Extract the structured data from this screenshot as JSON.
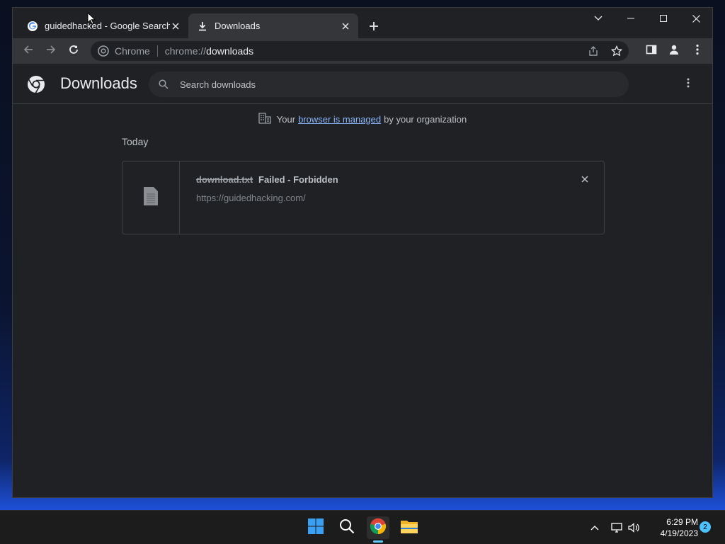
{
  "tabs": [
    {
      "label": "guidedhacked - Google Search",
      "icon": "google-g-icon"
    },
    {
      "label": "Downloads",
      "icon": "download-icon"
    }
  ],
  "omnibox": {
    "chip": "Chrome",
    "url_scheme": "chrome://",
    "url_host": "downloads"
  },
  "header": {
    "title": "Downloads",
    "search_placeholder": "Search downloads"
  },
  "managed": {
    "prefix": "Your",
    "link": "browser is managed",
    "suffix": "by your organization"
  },
  "section": {
    "day": "Today"
  },
  "download": {
    "filename": "download.txt",
    "status": "Failed - Forbidden",
    "url": "https://guidedhacking.com/"
  },
  "taskbar": {
    "time": "6:29 PM",
    "date": "4/19/2023",
    "notifications": "2"
  },
  "colors": {
    "accent": "#8ab4f8",
    "background": "#202124",
    "toolbar": "#35363a"
  }
}
